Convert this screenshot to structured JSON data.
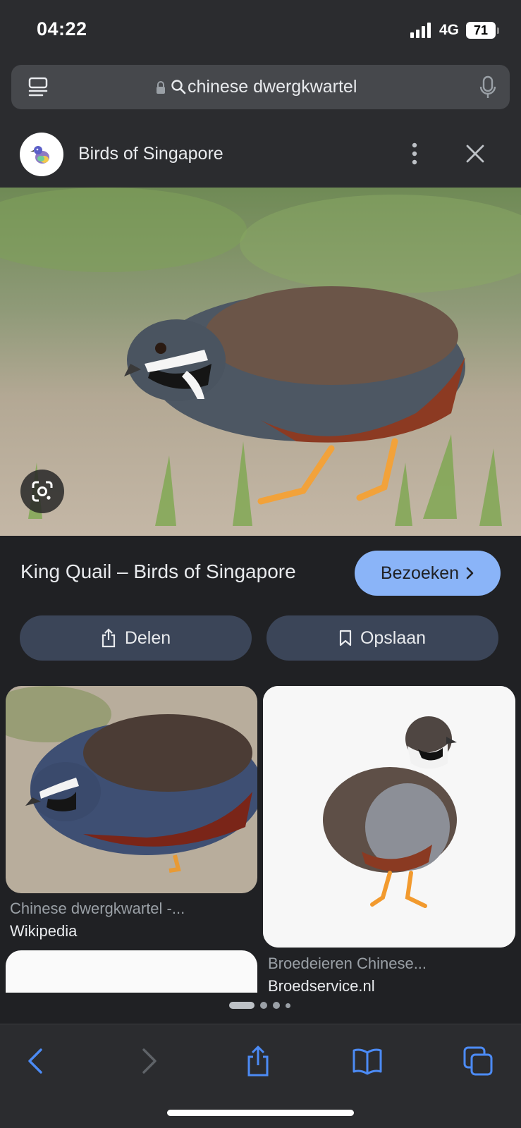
{
  "status": {
    "time": "04:22",
    "network": "4G",
    "battery": "71"
  },
  "urlbar": {
    "query": "chinese dwergkwartel"
  },
  "source": {
    "name": "Birds of Singapore"
  },
  "result": {
    "title": "King Quail – Birds of Singapore",
    "visit_label": "Bezoeken",
    "share_label": "Delen",
    "save_label": "Opslaan"
  },
  "grid": [
    {
      "title": "Chinese dwergkwartel -...",
      "source": "Wikipedia"
    },
    {
      "title": "Broedeieren Chinese...",
      "source": "Broedservice.nl"
    }
  ],
  "pager": {
    "total": 4,
    "active": 0
  },
  "colors": {
    "accent": "#8ab4f8",
    "background": "#202124",
    "chip": "#3b4558",
    "toolbar_icon": "#4c8bf5"
  }
}
